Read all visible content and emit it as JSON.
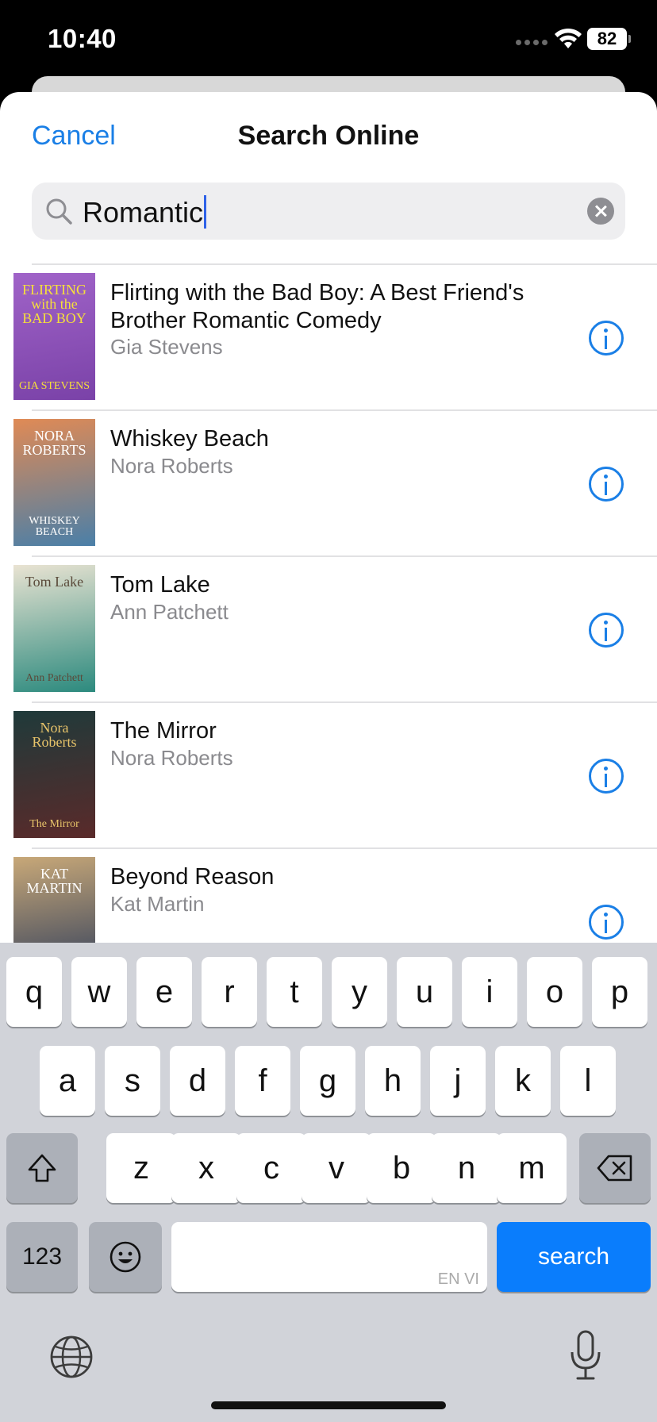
{
  "status_bar": {
    "time": "10:40",
    "battery": "82"
  },
  "header": {
    "cancel_label": "Cancel",
    "title": "Search Online"
  },
  "search": {
    "value": "Romantic"
  },
  "results": [
    {
      "title": "Flirting with the Bad Boy: A Best Friend's Brother Romantic Comedy",
      "author": "Gia Stevens",
      "cover_text": "FLIRTING with the BAD BOY",
      "cover_author": "GIA STEVENS",
      "cover_colors": [
        "#a063c8",
        "#7a42a8"
      ],
      "cover_text_color": "#f6e03a"
    },
    {
      "title": "Whiskey Beach",
      "author": "Nora Roberts",
      "cover_text": "NORA ROBERTS",
      "cover_author": "WHISKEY BEACH",
      "cover_colors": [
        "#e08a55",
        "#4a7fa8"
      ],
      "cover_text_color": "#ffffff"
    },
    {
      "title": "Tom Lake",
      "author": "Ann Patchett",
      "cover_text": "Tom Lake",
      "cover_author": "Ann Patchett",
      "cover_colors": [
        "#e9e3d2",
        "#2c8a7e"
      ],
      "cover_text_color": "#5a4a3a"
    },
    {
      "title": "The Mirror",
      "author": "Nora Roberts",
      "cover_text": "Nora Roberts",
      "cover_author": "The Mirror",
      "cover_colors": [
        "#1f3a3a",
        "#5a2a2a"
      ],
      "cover_text_color": "#e8c46a"
    },
    {
      "title": "Beyond Reason",
      "author": "Kat Martin",
      "cover_text": "KAT MARTIN",
      "cover_author": "",
      "cover_colors": [
        "#c8a878",
        "#2a3a5a"
      ],
      "cover_text_color": "#ffffff"
    }
  ],
  "keyboard": {
    "row1": [
      "q",
      "w",
      "e",
      "r",
      "t",
      "y",
      "u",
      "i",
      "o",
      "p"
    ],
    "row2": [
      "a",
      "s",
      "d",
      "f",
      "g",
      "h",
      "j",
      "k",
      "l"
    ],
    "row3": [
      "z",
      "x",
      "c",
      "v",
      "b",
      "n",
      "m"
    ],
    "numbers_label": "123",
    "search_label": "search",
    "space_lang": "EN VI"
  },
  "colors": {
    "accent": "#1a7fe6",
    "search_key": "#0a7dfc"
  }
}
